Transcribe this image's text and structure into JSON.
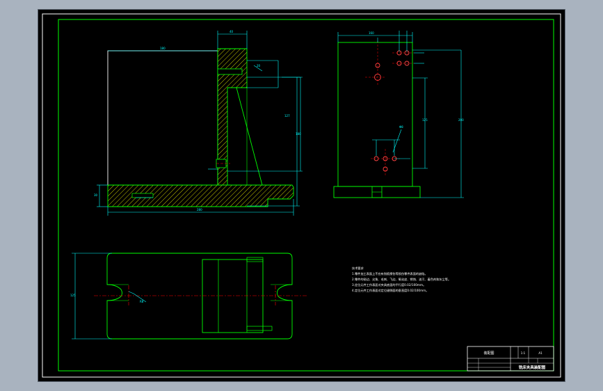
{
  "drawing": {
    "colors": {
      "background": "#000000",
      "window_bg": "#a9b3bf",
      "border": "#ffffff",
      "outline": "#00ff00",
      "dimension": "#00ffff",
      "centerline": "#ff0000",
      "hatch": "#ffff00",
      "note_text": "#ffffff"
    },
    "notes": {
      "heading": "技术要求",
      "line1": "1.零件加工表面上不应有划痕擦伤等损伤零件表面的缺陷。",
      "line2": "2.零件的锐边、尖角、毛刺、飞边、氧化皮、锈蚀、油污、着色剂和灰尘等。",
      "line3": "3.定位元件工作表面对夹具底面的平行度0.02/100mm。",
      "line4": "4.定位元件工作表面对定位键侧面的垂直度0.02/100mm。"
    },
    "title_block": {
      "title": "铣床夹具装配图",
      "left_label": "装配图",
      "scale": "1:1",
      "code": "A1"
    }
  }
}
